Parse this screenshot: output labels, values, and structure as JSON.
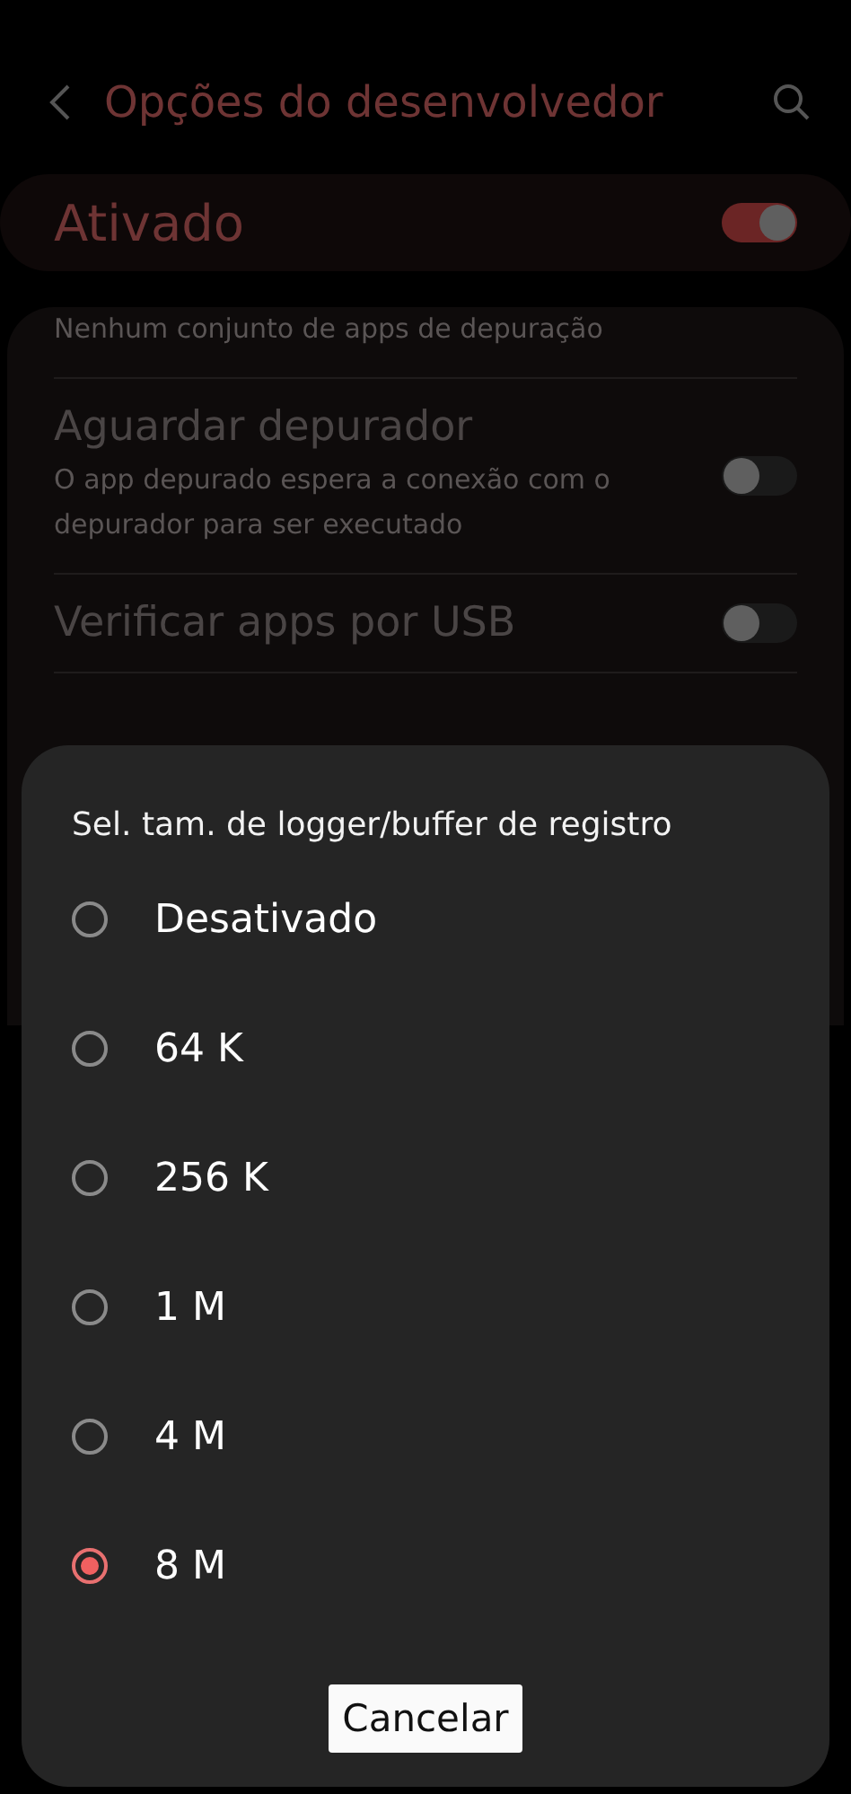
{
  "header": {
    "title": "Opções do desenvolvedor"
  },
  "master_switch": {
    "label": "Ativado",
    "on": true
  },
  "settings": [
    {
      "subtitle": "Nenhum conjunto de apps de depuração",
      "kind": "text"
    },
    {
      "title": "Aguardar depurador",
      "subtitle": "O app depurado espera a conexão com o depurador para ser executado",
      "kind": "switch",
      "on": false
    },
    {
      "title": "Verificar apps por USB",
      "kind": "switch",
      "on": false
    }
  ],
  "dialog": {
    "title": "Sel. tam. de logger/buffer de registro",
    "options": [
      {
        "label": "Desativado",
        "selected": false
      },
      {
        "label": "64 K",
        "selected": false
      },
      {
        "label": "256 K",
        "selected": false
      },
      {
        "label": "1 M",
        "selected": false
      },
      {
        "label": "4 M",
        "selected": false
      },
      {
        "label": "8 M",
        "selected": true
      }
    ],
    "button": "Cancelar"
  }
}
